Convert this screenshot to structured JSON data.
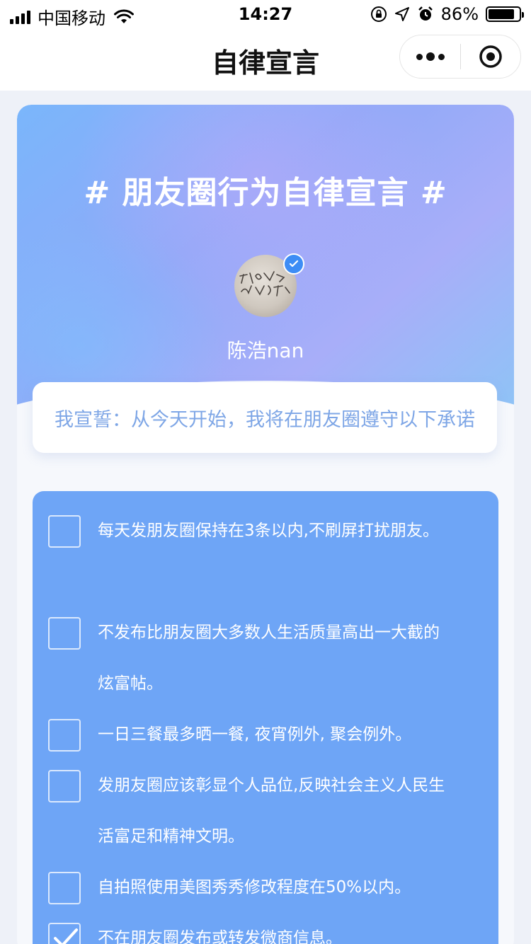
{
  "status_bar": {
    "carrier": "中国移动",
    "time": "14:27",
    "battery_percent": "86%",
    "battery_level": 0.86
  },
  "nav": {
    "title": "自律宣言"
  },
  "hero": {
    "title": "# 朋友圈行为自律宣言 #",
    "username": "陈浩nan"
  },
  "pledge": {
    "text": "我宣誓：从今天开始，我将在朋友圈遵守以下承诺"
  },
  "items": [
    {
      "text": "每天发朋友圈保持在3条以内,不刷屏打扰朋友。",
      "checked": false
    },
    {
      "text": "不发布比朋友圈大多数人生活质量高出一大截的炫富帖。",
      "checked": false
    },
    {
      "text": "一日三餐最多晒一餐, 夜宵例外, 聚会例外。",
      "checked": false
    },
    {
      "text": "发朋友圈应该彰显个人品位,反映社会主义人民生活富足和精神文明。",
      "checked": false
    },
    {
      "text": "自拍照使用美图秀秀修改程度在50%以内。",
      "checked": false
    },
    {
      "text": "不在朋友圈发布或转发微商信息。",
      "checked": true
    }
  ],
  "colors": {
    "panel": "#6ea5f6",
    "pledge_text": "#7ea6e6",
    "verify_badge": "#3d8df5"
  }
}
